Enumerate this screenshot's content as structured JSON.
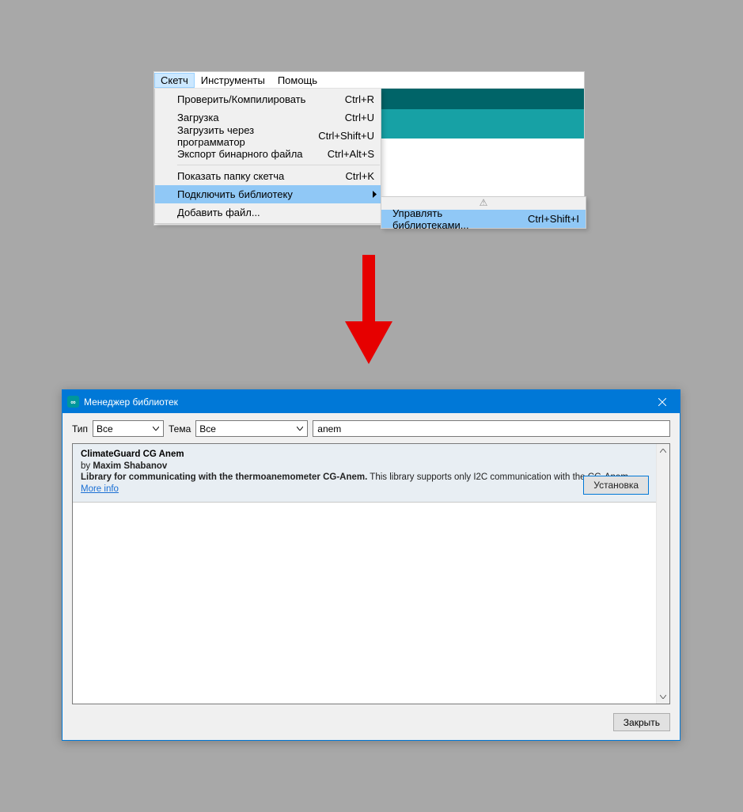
{
  "menu_bar": {
    "sketch": "Скетч",
    "tools": "Инструменты",
    "help": "Помощь"
  },
  "dropdown": {
    "verify": {
      "label": "Проверить/Компилировать",
      "shortcut": "Ctrl+R"
    },
    "upload": {
      "label": "Загрузка",
      "shortcut": "Ctrl+U"
    },
    "upload_prog": {
      "label": "Загрузить через программатор",
      "shortcut": "Ctrl+Shift+U"
    },
    "export": {
      "label": "Экспорт бинарного файла",
      "shortcut": "Ctrl+Alt+S"
    },
    "show_folder": {
      "label": "Показать папку скетча",
      "shortcut": "Ctrl+K"
    },
    "include_lib": {
      "label": "Подключить библиотеку"
    },
    "add_file": {
      "label": "Добавить файл..."
    }
  },
  "submenu": {
    "warn": "⚠",
    "manage": {
      "label": "Управлять библиотеками...",
      "shortcut": "Ctrl+Shift+I"
    }
  },
  "dialog": {
    "title": "Менеджер библиотек",
    "type_label": "Тип",
    "type_value": "Все",
    "topic_label": "Тема",
    "topic_value": "Все",
    "search_value": "anem",
    "close_button": "Закрыть"
  },
  "library": {
    "name": "ClimateGuard CG Anem",
    "by_word": "by",
    "author": "Maxim Shabanov",
    "desc_bold": "Library for communicating with the thermoanemometer CG-Anem.",
    "desc_rest": " This library supports only I2C communication with the CG-Anem.",
    "more_info": "More info",
    "install": "Установка"
  }
}
